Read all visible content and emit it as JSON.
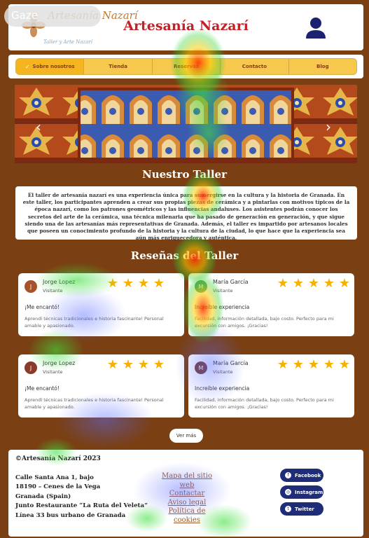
{
  "overlay": {
    "gaze_label": "Gaze"
  },
  "header": {
    "logo_name": "Artesanía Nazarí",
    "logo_tagline": "Taller y Arte Nazarí",
    "title": "Artesanía Nazarí",
    "user_icon": "user-icon"
  },
  "nav": {
    "items": [
      {
        "label": "Sobre nosotros",
        "active": true
      },
      {
        "label": "Tienda",
        "active": false
      },
      {
        "label": "Reservas",
        "active": false
      },
      {
        "label": "Contacto",
        "active": false
      },
      {
        "label": "Blog",
        "active": false
      }
    ]
  },
  "carousel": {
    "prev_icon": "chevron-left-icon",
    "next_icon": "chevron-right-icon"
  },
  "about": {
    "title": "Nuestro Taller",
    "text": "El taller de artesanía nazarí es una experiencia única para sumergirse en la cultura y la historia de Granada. En este taller, los participantes aprenden a crear sus propias piezas de cerámica y a pintarlas con motivos típicos de la época nazarí, como los patrones geométricos y las influencias andaluses. Los asistentes podrán conocer los secretos del arte de la cerámica, una técnica milenaria que ha pasado de generación en generación, y que sigue siendo una de las artesanías más representativas de Granada. Además, el taller es impartido por artesanos locales que poseen un conocimiento profundo de la historia y la cultura de la ciudad, lo que hace que la experiencia sea aún más enriquecedora y auténtica."
  },
  "reviews": {
    "title": "Reseñas del Taller",
    "items": [
      {
        "initial": "J",
        "name": "Jorge Lopez",
        "role": "Visitante",
        "stars": 4,
        "headline": "¡Me encantó!",
        "body": "Aprendí técnicas tradicionales e historia fascinante! Personal amable y apasionado.",
        "avatar_color": "#a8522a"
      },
      {
        "initial": "M",
        "name": "María García",
        "role": "Visitante",
        "stars": 5,
        "headline": "Increíble experiencia",
        "body": "Facilidad, información detallada, bajo costo. Perfecto para mi excursión con amigos. ¡Gracias!",
        "avatar_color": "#5aa15a"
      },
      {
        "initial": "J",
        "name": "Jorge Lopez",
        "role": "Visitante",
        "stars": 4,
        "headline": "¡Me encantó!",
        "body": "Aprendí técnicas tradicionales e historia fascinante! Personal amable y apasionado.",
        "avatar_color": "#8a3b2a"
      },
      {
        "initial": "M",
        "name": "María García",
        "role": "Visitante",
        "stars": 5,
        "headline": "Increíble experiencia",
        "body": "Facilidad, información detallada, bajo costo. Perfecto para mi excursión con amigos. ¡Gracias!",
        "avatar_color": "#7a3a2a"
      }
    ],
    "more_label": "Ver más"
  },
  "footer": {
    "copyright": "©Artesanía Nazarí 2023",
    "address": "Calle Santa Ana 1, bajo\n18190 – Cenes de la Vega\nGranada (Spain)\nJunto Restaurante “La Ruta del Veleta”\nLínea 33 bus urbano de Granada",
    "links": [
      "Mapa del sitio web",
      "Contactar",
      "Aviso legal",
      "Política de cookies"
    ],
    "social": [
      {
        "label": "Facebook",
        "icon": "facebook-icon"
      },
      {
        "label": "Instagram",
        "icon": "instagram-icon"
      },
      {
        "label": "Twitter",
        "icon": "twitter-icon"
      }
    ]
  }
}
